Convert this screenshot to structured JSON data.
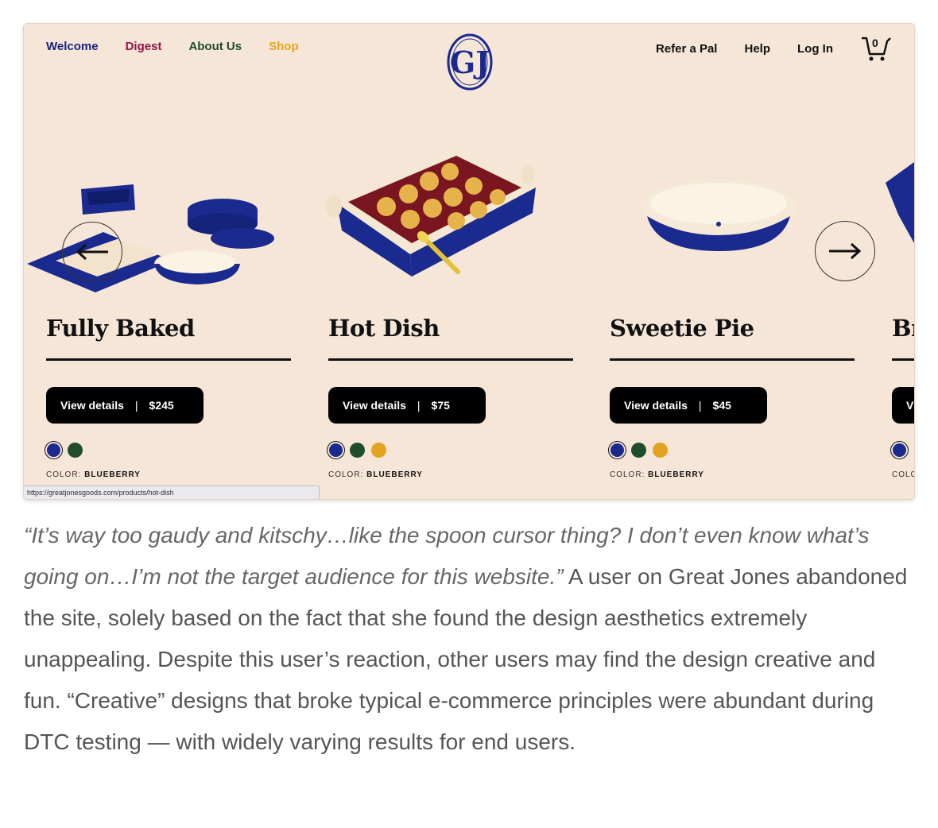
{
  "nav": {
    "left": [
      {
        "label": "Welcome",
        "color": "#1a237e"
      },
      {
        "label": "Digest",
        "color": "#8e1446"
      },
      {
        "label": "About Us",
        "color": "#1f4d2b"
      },
      {
        "label": "Shop",
        "color": "#e8a21c"
      }
    ],
    "right": [
      "Refer a Pal",
      "Help",
      "Log In"
    ],
    "cart_count": "0"
  },
  "products": [
    {
      "title": "Fully Baked",
      "button_label": "View details",
      "price": "$245",
      "swatches": [
        "#1b2a8f",
        "#1f4d2b"
      ],
      "color_label": "COLOR:",
      "color_value": "BLUEBERRY"
    },
    {
      "title": "Hot Dish",
      "button_label": "View details",
      "price": "$75",
      "swatches": [
        "#1b2a8f",
        "#1f4d2b",
        "#e3a21f"
      ],
      "color_label": "COLOR:",
      "color_value": "BLUEBERRY"
    },
    {
      "title": "Sweetie Pie",
      "button_label": "View details",
      "price": "$45",
      "swatches": [
        "#1b2a8f",
        "#1f4d2b",
        "#e3a21f"
      ],
      "color_label": "COLOR:",
      "color_value": "BLUEBERRY"
    },
    {
      "title": "Bı",
      "button_label": "V",
      "price": "",
      "swatches": [
        "#1b2a8f"
      ],
      "color_label": "COLO",
      "color_value": ""
    }
  ],
  "status_url": "https://greatjonesgoods.com/products/hot-dish",
  "caption": {
    "quote": "“It’s way too gaudy and kitschy…like the spoon cursor thing? I don’t even know what’s going on…I’m not the target audience for this website.”",
    "body": " A user on Great Jones abandoned the site, solely based on the fact that she found the design aesthetics extremely unappealing. Despite this user’s reaction, other users may find the design creative and fun. “Creative” designs that broke typical e-commerce principles were abundant during DTC testing — with widely varying results for end users."
  },
  "colors": {
    "page_bg": "#f6e6d8",
    "brand_blue": "#1b2a8f",
    "button_bg": "#000000"
  }
}
